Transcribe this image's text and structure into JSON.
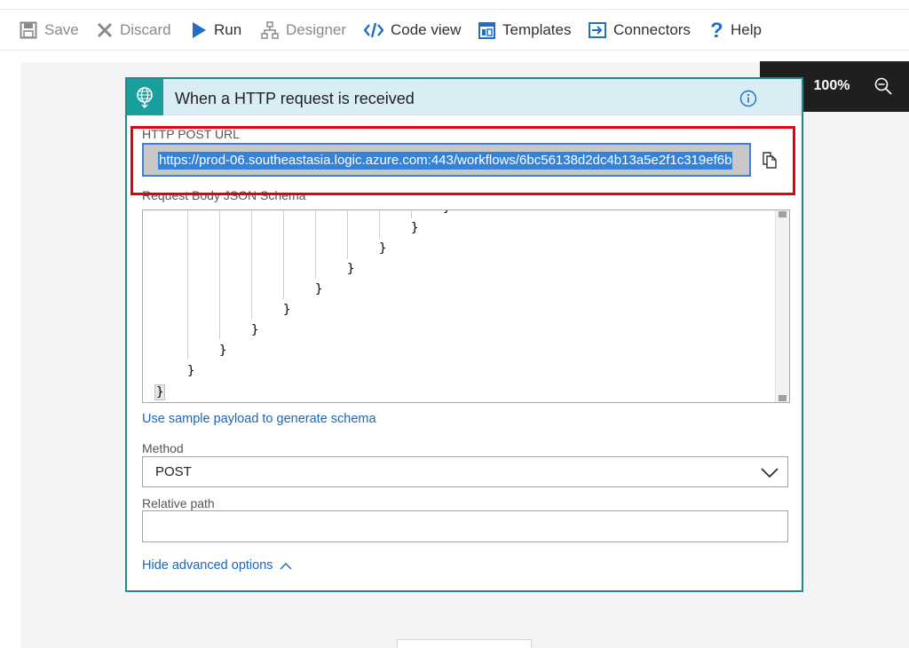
{
  "toolbar": {
    "save_label": "Save",
    "discard_label": "Discard",
    "run_label": "Run",
    "designer_label": "Designer",
    "codeview_label": "Code view",
    "templates_label": "Templates",
    "connectors_label": "Connectors",
    "help_label": "Help"
  },
  "zoom": {
    "level": "100%"
  },
  "trigger": {
    "title": "When a HTTP request is received",
    "url_label": "HTTP POST URL",
    "url_value": "https://prod-06.southeastasia.logic.azure.com:443/workflows/6bc56138d2dc4b13a5e2f1c319ef6b",
    "schema_label": "Request Body JSON Schema",
    "schema_braces": [
      "}",
      "}",
      "}",
      "}",
      "}",
      "}",
      "}",
      "}",
      "}",
      "}"
    ],
    "sample_payload_link": "Use sample payload to generate schema",
    "method_label": "Method",
    "method_value": "POST",
    "relative_path_label": "Relative path",
    "relative_path_value": "",
    "advanced_toggle": "Hide advanced options"
  },
  "colors": {
    "accent_teal": "#1a9f9f",
    "header_bg": "#d9eef4",
    "link_blue": "#1a67b8",
    "highlight_red": "#e3000f",
    "selection_blue": "#3583d8"
  },
  "icons": [
    "save-icon",
    "discard-icon",
    "run-icon",
    "designer-icon",
    "code-view-icon",
    "templates-icon",
    "connectors-icon",
    "help-icon",
    "zoom-in-icon",
    "zoom-out-icon",
    "http-trigger-icon",
    "info-icon",
    "copy-icon",
    "chevron-down-icon",
    "chevron-up-icon"
  ]
}
